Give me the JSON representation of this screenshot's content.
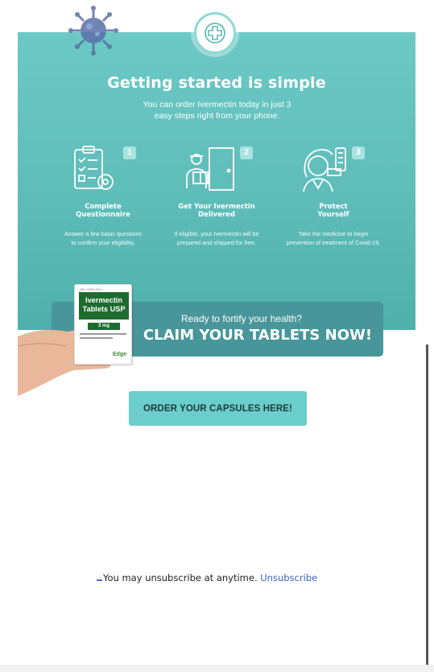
{
  "hero": {
    "headline": "Getting started is simple",
    "subline": "You can order Ivermectin today in just 3\neasy steps right from your phone.",
    "colors": {
      "teal": "#5fbdb9",
      "badge": "#a9e3e0",
      "cta_box": "#48969a"
    }
  },
  "icons": {
    "virus": "virus-icon",
    "cross": "medical-cross-icon",
    "step1": "clipboard-questionnaire-icon",
    "step2": "delivery-man-icon",
    "step3": "doctor-icon"
  },
  "steps": [
    {
      "number": "1",
      "title": "Complete\nQuestionnaire",
      "desc": "Answer a few basic questions\nto confirm your eligibility."
    },
    {
      "number": "2",
      "title": "Get Your Ivermectin\nDelivered",
      "desc": "If eligible, your Ivermectin will be\nprepared and shipped for free."
    },
    {
      "number": "3",
      "title": "Protect\nYourself",
      "desc": "Take the medicine to begin\nprevention of treatment of Covid-19."
    }
  ],
  "product": {
    "name": "Ivermectin\nTablets USP",
    "dose": "3 mg",
    "brand": "Edge"
  },
  "cta": {
    "small": "Ready to fortify your health?",
    "big": "CLAIM YOUR TABLETS NOW!"
  },
  "order_button": {
    "label": "ORDER YOUR CAPSULES HERE!",
    "color": "#6ccecb"
  },
  "footer": {
    "text": "You may unsubscribe at anytime. ",
    "link": "Unsubscribe"
  }
}
